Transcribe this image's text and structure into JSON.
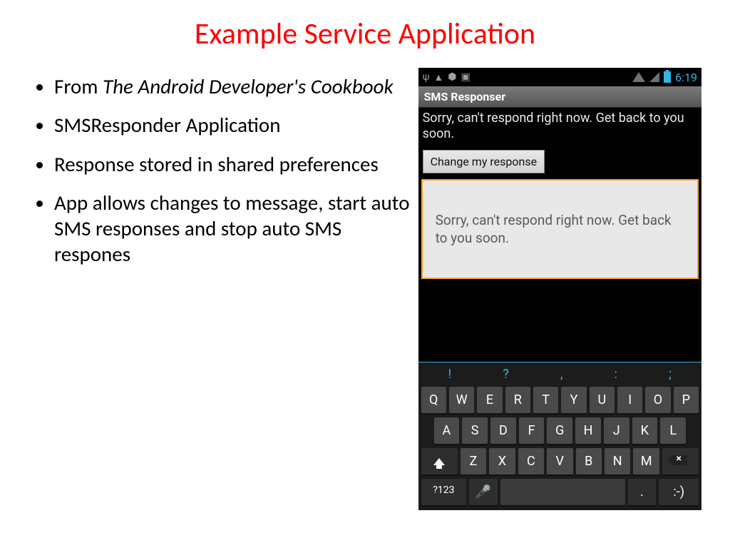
{
  "title": "Example Service Application",
  "bullets": {
    "b1_prefix": "From ",
    "b1_italic": "The Android Developer's Cookbook",
    "b2": "SMSResponder Application",
    "b3": "Response stored in shared preferences",
    "b4": "App allows changes to message, start auto SMS responses and stop auto SMS respones"
  },
  "phone": {
    "statusTime": "6:19",
    "appTitle": "SMS Responser",
    "currentMessage": "Sorry, can't respond right now. Get back to you soon.",
    "buttonLabel": "Change my response",
    "inputText": "Sorry, can't respond right now. Get back to you soon."
  },
  "keyboard": {
    "punct": [
      "!",
      "?",
      ",",
      ":",
      ";"
    ],
    "row1": [
      "Q",
      "W",
      "E",
      "R",
      "T",
      "Y",
      "U",
      "I",
      "O",
      "P"
    ],
    "row2": [
      "A",
      "S",
      "D",
      "F",
      "G",
      "H",
      "J",
      "K",
      "L"
    ],
    "row3": [
      "Z",
      "X",
      "C",
      "V",
      "B",
      "N",
      "M"
    ],
    "numKey": "?123",
    "dot": ".",
    "smile": ":-)"
  }
}
